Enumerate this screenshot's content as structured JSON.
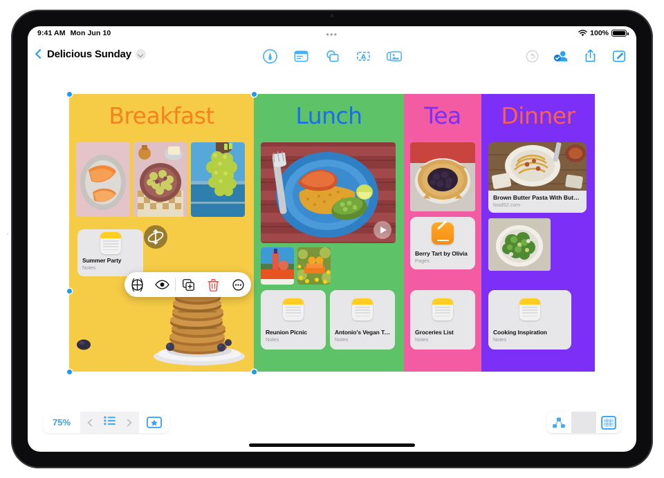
{
  "status_bar": {
    "time": "9:41 AM",
    "date": "Mon Jun 10",
    "wifi_icon": "wifi-icon",
    "battery_percent": "100%",
    "battery_icon": "battery-icon"
  },
  "navbar": {
    "back_icon": "chevron-left-icon",
    "document_title": "Delicious Sunday",
    "title_menu_icon": "chevron-down-icon",
    "center_tools": [
      {
        "name": "markup-pen-tool",
        "label": "Markup"
      },
      {
        "name": "sticky-note-tool",
        "label": "Note"
      },
      {
        "name": "shapes-tool",
        "label": "Shape"
      },
      {
        "name": "text-box-tool",
        "label": "Text"
      },
      {
        "name": "media-tool",
        "label": "Media"
      }
    ],
    "right_tools": [
      {
        "name": "undo-button",
        "label": "Undo",
        "enabled": false
      },
      {
        "name": "collaborate-button",
        "label": "Collaborate",
        "enabled": true
      },
      {
        "name": "share-button",
        "label": "Share",
        "enabled": true
      },
      {
        "name": "compose-button",
        "label": "Compose",
        "enabled": true
      }
    ]
  },
  "board": {
    "columns": [
      {
        "id": "breakfast",
        "title": "Breakfast",
        "bg_color": "#f6cb46",
        "title_color": "#f58220",
        "selected": true,
        "photos": [
          "melon-slices-photo",
          "figs-on-plate-photo",
          "grapes-by-sea-photo",
          "pancake-stack-photo"
        ],
        "cards": [
          {
            "title": "Summer Party",
            "subtitle": "Notes",
            "app": "notes"
          }
        ]
      },
      {
        "id": "lunch",
        "title": "Lunch",
        "bg_color": "#5ec269",
        "title_color": "#1a6cf0",
        "selected": false,
        "photos": [
          "tacos-rice-plate-video",
          "juice-bottles-photo",
          "oranges-field-photo"
        ],
        "cards": [
          {
            "title": "Reunion Picnic",
            "subtitle": "Notes",
            "app": "notes"
          },
          {
            "title": "Antonio's Vegan Tacos",
            "subtitle": "Notes",
            "app": "notes"
          }
        ]
      },
      {
        "id": "tea",
        "title": "Tea",
        "bg_color": "#f35ba3",
        "title_color": "#7b2ff7",
        "selected": false,
        "photos": [
          "berry-galette-photo"
        ],
        "cards": [
          {
            "title": "Berry Tart by Olivia",
            "subtitle": "Pages",
            "app": "pages"
          },
          {
            "title": "Groceries List",
            "subtitle": "Notes",
            "app": "notes"
          }
        ]
      },
      {
        "id": "dinner",
        "title": "Dinner",
        "bg_color": "#7b2ff7",
        "title_color": "#f9604d",
        "selected": false,
        "photos": [
          "pasta-dinner-photo",
          "green-salad-bowl-photo"
        ],
        "link_card": {
          "title": "Brown Butter Pasta With But…",
          "host": "food52.com"
        },
        "cards": [
          {
            "title": "Cooking Inspiration",
            "subtitle": "Notes",
            "app": "notes"
          }
        ]
      }
    ],
    "video_play_icon": "play-icon",
    "rotate_badge_icon": "move-rotate-icon"
  },
  "context_menu": {
    "items": [
      {
        "name": "move-to-icon",
        "label": "Move To"
      },
      {
        "name": "preview-eye-icon",
        "label": "Preview"
      },
      {
        "name": "duplicate-icon",
        "label": "Duplicate"
      },
      {
        "name": "delete-trash-icon",
        "label": "Delete",
        "color": "#ff3b30"
      },
      {
        "name": "more-ellipsis-icon",
        "label": "More"
      }
    ]
  },
  "bottom_bar": {
    "zoom_level": "75%",
    "prev_icon": "chevron-left-icon",
    "list_icon": "list-icon",
    "next_icon": "chevron-right-icon",
    "star_card_icon": "star-card-icon",
    "map_view_icon": "node-map-icon",
    "board_view_icon": "board-grid-icon",
    "board_view_selected": true
  },
  "colors": {
    "accent_blue": "#1a9bf0",
    "delete_red": "#ff3b30",
    "notes_yellow": "#ffce21",
    "pages_orange": "#f78c14"
  }
}
